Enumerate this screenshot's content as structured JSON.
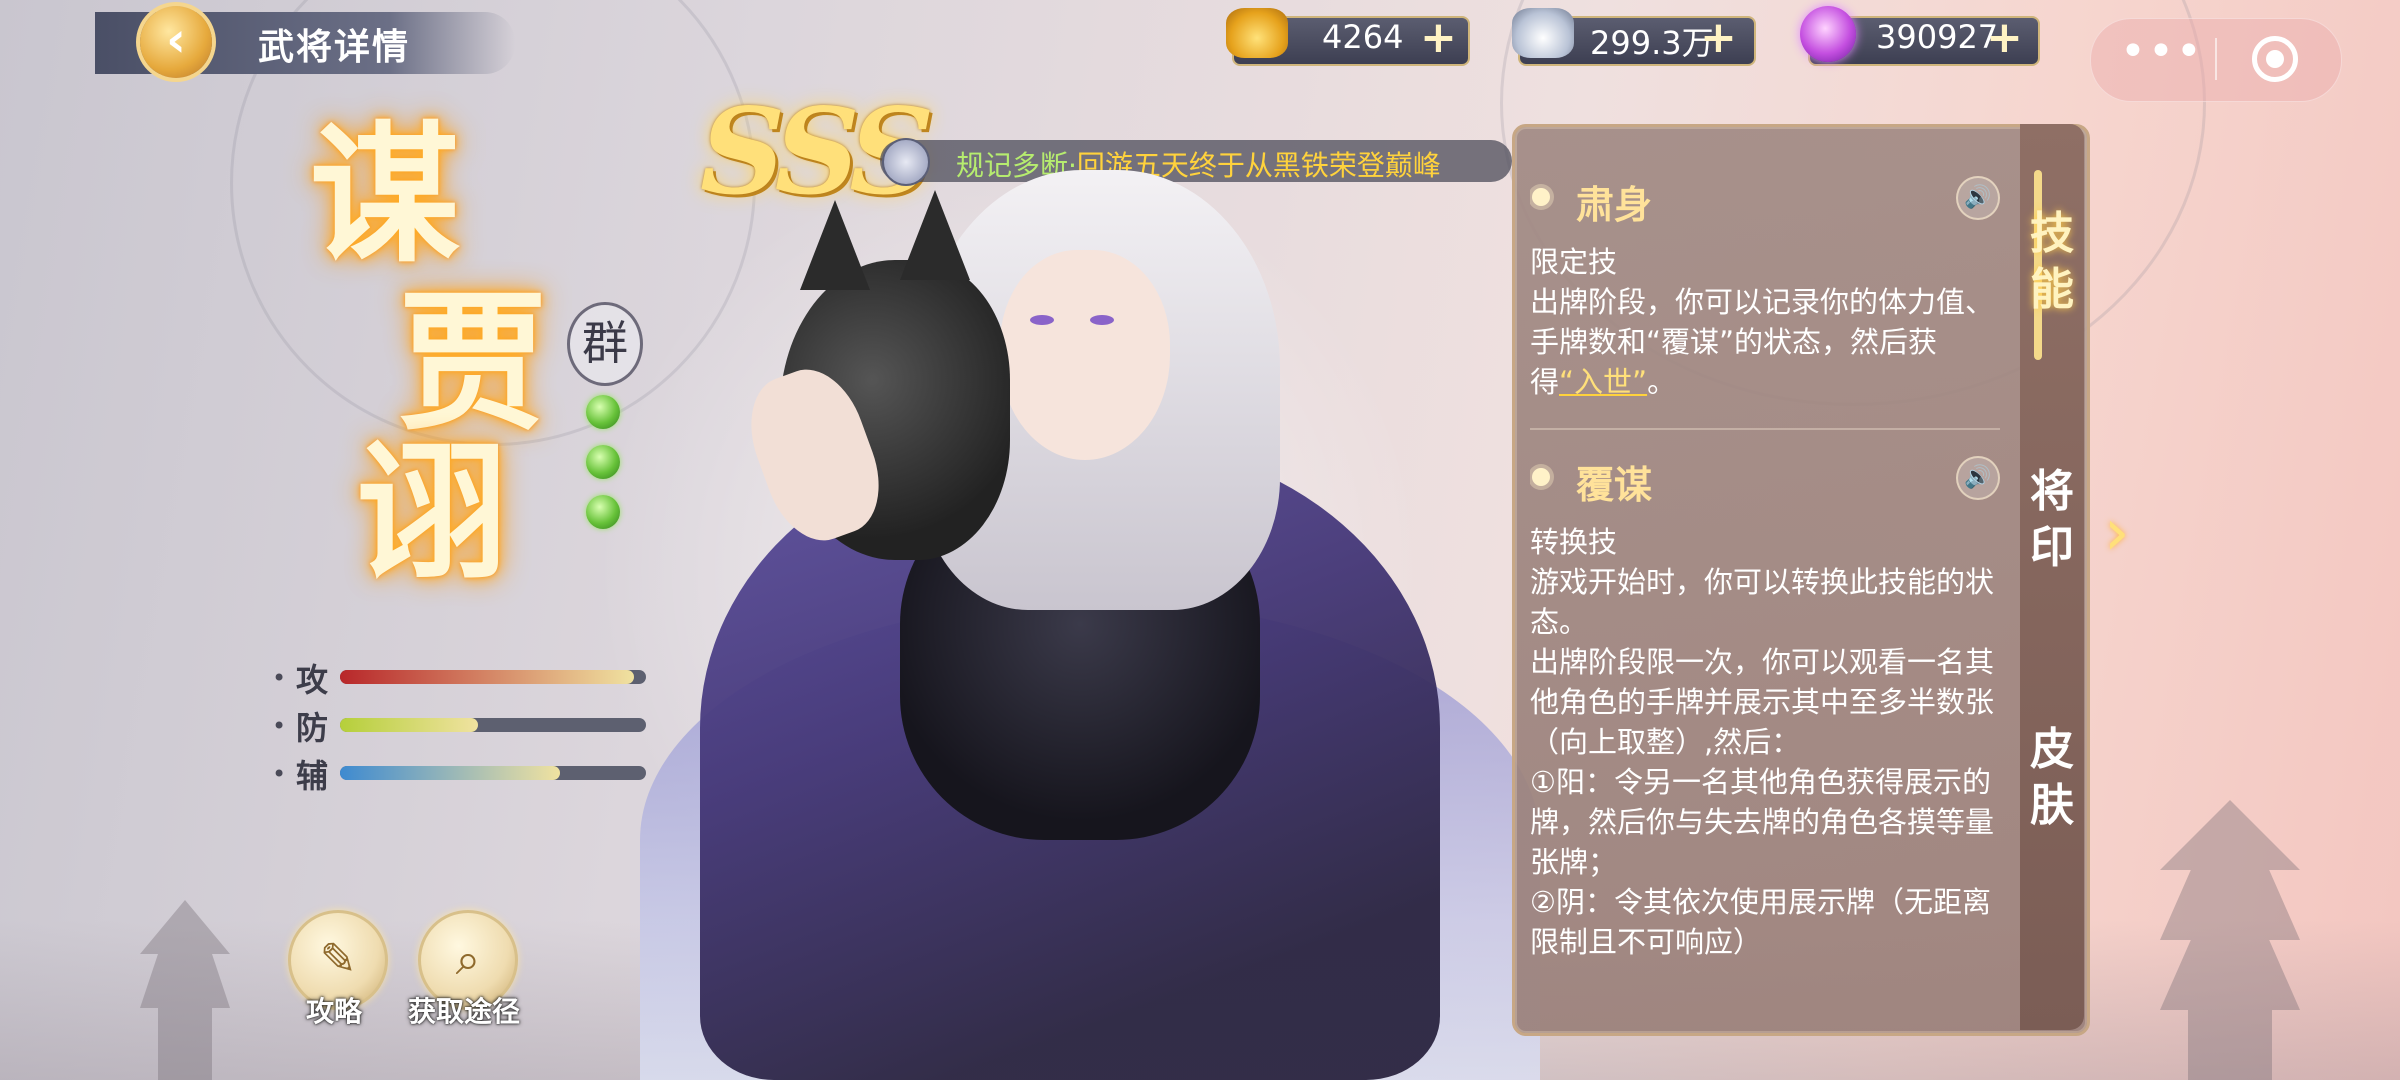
{
  "header": {
    "back_title": "武将详情",
    "resources": [
      {
        "icon": "gold-ingot-icon",
        "value": "4264",
        "plus": "+"
      },
      {
        "icon": "silver-ingot-icon",
        "value": "299.3万",
        "plus": "+"
      },
      {
        "icon": "purple-orb-icon",
        "value": "390927",
        "plus": "+"
      }
    ],
    "mini": {
      "more": "•••"
    }
  },
  "hero": {
    "name_chars": [
      "谋",
      "贾",
      "诩"
    ],
    "faction": "群",
    "jade_count": 3,
    "rating": "SSS",
    "title_part1": "规记多断·",
    "title_part2": "回游五天终于从黑铁荣登巅峰"
  },
  "stats": [
    {
      "label": "攻",
      "value": 0.96,
      "color": "#b8272a"
    },
    {
      "label": "防",
      "value": 0.45,
      "color": "#b5cf3a"
    },
    {
      "label": "辅",
      "value": 0.72,
      "color": "#3e8ad0"
    }
  ],
  "buttons": {
    "guide": "攻略",
    "obtain": "获取途径"
  },
  "skills": [
    {
      "name": "肃身",
      "type": "限定技",
      "desc_before": "出牌阶段，你可以记录你的体力值、手牌数和“覆谋”的状态，然后获得",
      "keyword": "“入世”",
      "desc_after": "。"
    },
    {
      "name": "覆谋",
      "type": "转换技",
      "desc": "游戏开始时，你可以转换此技能的状态。\n出牌阶段限一次，你可以观看一名其他角色的手牌并展示其中至多半数张（向上取整）,然后：\n①阳：令另一名其他角色获得展示的牌，然后你与失去牌的角色各摸等量张牌；\n②阴：令其依次使用展示牌（无距离限制且不可响应）"
    }
  ],
  "tabs": [
    "技能",
    "将印",
    "皮肤"
  ],
  "colors": {
    "accent": "#ffe29a",
    "panel": "#9a807a"
  }
}
